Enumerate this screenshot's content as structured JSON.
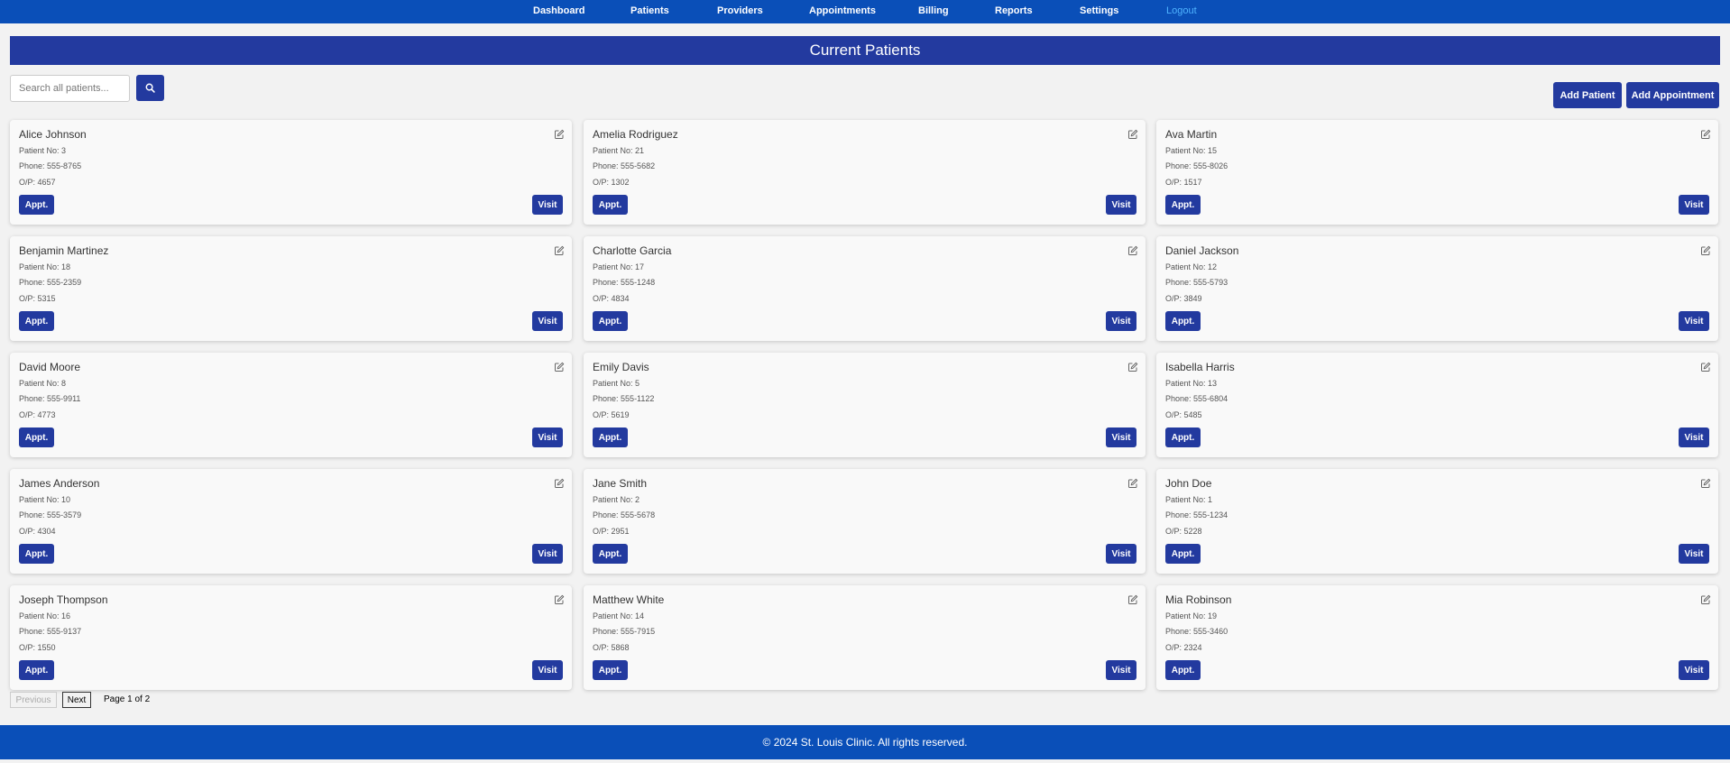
{
  "nav": {
    "items": [
      "Dashboard",
      "Patients",
      "Providers",
      "Appointments",
      "Billing",
      "Reports",
      "Settings"
    ],
    "logout": "Logout"
  },
  "page_title": "Current Patients",
  "search": {
    "placeholder": "Search all patients...",
    "icon": "search-icon"
  },
  "actions": {
    "add_patient": "Add Patient",
    "add_appointment": "Add Appointment"
  },
  "card_labels": {
    "patient_no": "Patient No:",
    "phone": "Phone:",
    "op": "O/P:",
    "appt": "Appt.",
    "visit": "Visit",
    "edit_icon": "edit-icon"
  },
  "patients": [
    {
      "name": "Alice Johnson",
      "patient_no": "3",
      "phone": "555-8765",
      "op": "4657"
    },
    {
      "name": "Amelia Rodriguez",
      "patient_no": "21",
      "phone": "555-5682",
      "op": "1302"
    },
    {
      "name": "Ava Martin",
      "patient_no": "15",
      "phone": "555-8026",
      "op": "1517"
    },
    {
      "name": "Benjamin Martinez",
      "patient_no": "18",
      "phone": "555-2359",
      "op": "5315"
    },
    {
      "name": "Charlotte Garcia",
      "patient_no": "17",
      "phone": "555-1248",
      "op": "4834"
    },
    {
      "name": "Daniel Jackson",
      "patient_no": "12",
      "phone": "555-5793",
      "op": "3849"
    },
    {
      "name": "David Moore",
      "patient_no": "8",
      "phone": "555-9911",
      "op": "4773"
    },
    {
      "name": "Emily Davis",
      "patient_no": "5",
      "phone": "555-1122",
      "op": "5619"
    },
    {
      "name": "Isabella Harris",
      "patient_no": "13",
      "phone": "555-6804",
      "op": "5485"
    },
    {
      "name": "James Anderson",
      "patient_no": "10",
      "phone": "555-3579",
      "op": "4304"
    },
    {
      "name": "Jane Smith",
      "patient_no": "2",
      "phone": "555-5678",
      "op": "2951"
    },
    {
      "name": "John Doe",
      "patient_no": "1",
      "phone": "555-1234",
      "op": "5228"
    },
    {
      "name": "Joseph Thompson",
      "patient_no": "16",
      "phone": "555-9137",
      "op": "1550"
    },
    {
      "name": "Matthew White",
      "patient_no": "14",
      "phone": "555-7915",
      "op": "5868"
    },
    {
      "name": "Mia Robinson",
      "patient_no": "19",
      "phone": "555-3460",
      "op": "2324"
    }
  ],
  "pagination": {
    "previous": "Previous",
    "next": "Next",
    "page_info": "Page 1 of 2"
  },
  "footer": "© 2024 St. Louis Clinic. All rights reserved.",
  "colors": {
    "nav_blue": "#0a4fb8",
    "primary": "#233a9f",
    "logout_link": "#4fb3ff",
    "background": "#f2f2f2"
  }
}
